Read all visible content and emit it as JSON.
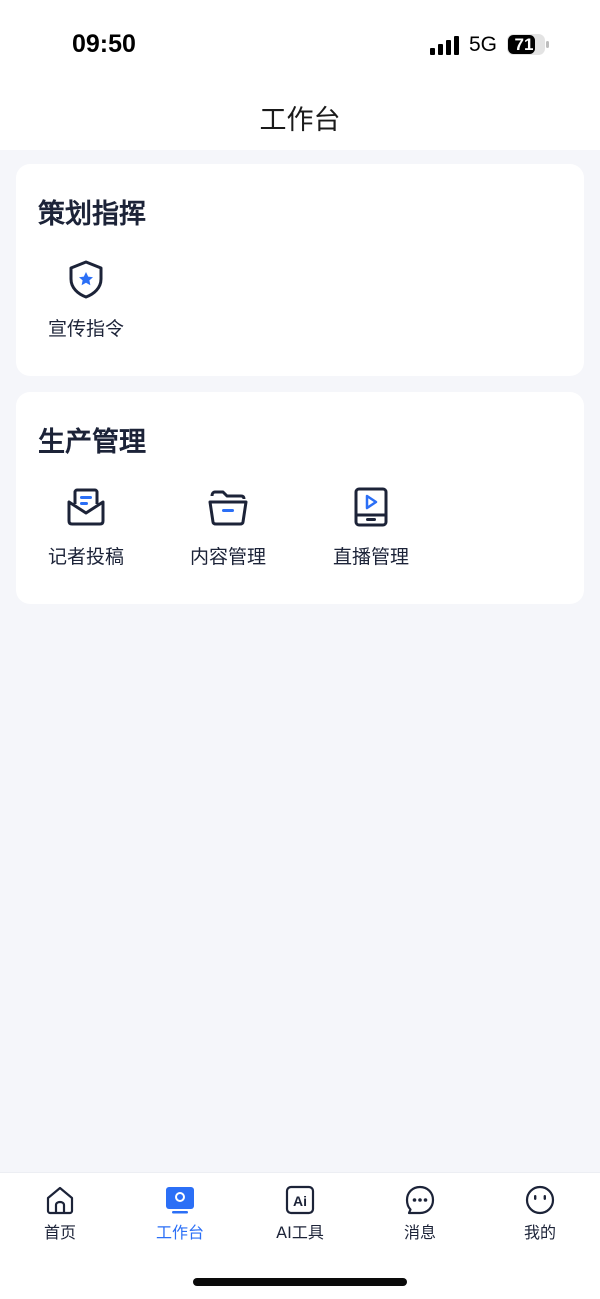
{
  "status_bar": {
    "time": "09:50",
    "network": "5G",
    "battery": "71"
  },
  "header": {
    "title": "工作台"
  },
  "sections": [
    {
      "title": "策划指挥",
      "items": [
        {
          "label": "宣传指令",
          "icon": "shield-star-icon"
        }
      ]
    },
    {
      "title": "生产管理",
      "items": [
        {
          "label": "记者投稿",
          "icon": "mail-document-icon"
        },
        {
          "label": "内容管理",
          "icon": "folder-icon"
        },
        {
          "label": "直播管理",
          "icon": "tablet-play-icon"
        }
      ]
    }
  ],
  "tabbar": {
    "active": "工作台",
    "items": [
      {
        "label": "首页",
        "icon": "home-icon"
      },
      {
        "label": "工作台",
        "icon": "workbench-icon"
      },
      {
        "label": "AI工具",
        "icon": "ai-icon"
      },
      {
        "label": "消息",
        "icon": "chat-bubble-icon"
      },
      {
        "label": "我的",
        "icon": "profile-face-icon"
      }
    ]
  },
  "colors": {
    "accent": "#2b6ff6",
    "text": "#1c2338",
    "background": "#f5f6fa"
  }
}
